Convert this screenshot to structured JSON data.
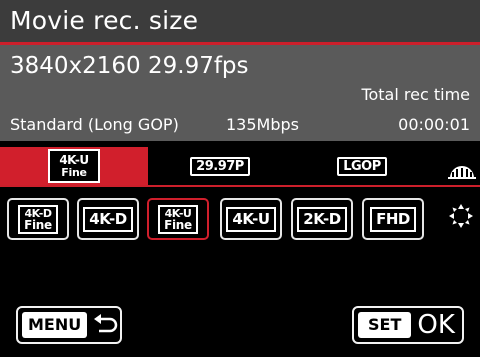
{
  "title": "Movie rec. size",
  "info": {
    "resolution_fps": "3840x2160 29.97fps",
    "total_rec_label": "Total rec time",
    "mode": "Standard (Long GOP)",
    "bitrate": "135Mbps",
    "time": "00:00:01"
  },
  "tabs": [
    {
      "line1": "4K-U",
      "line2": "Fine",
      "active": true
    },
    {
      "label": "29.97P"
    },
    {
      "label": "LGOP"
    }
  ],
  "options": [
    {
      "line1": "4K-D",
      "line2": "Fine"
    },
    {
      "label": "4K-D"
    },
    {
      "line1": "4K-U",
      "line2": "Fine",
      "selected": true
    },
    {
      "label": "4K-U"
    },
    {
      "label": "2K-D"
    },
    {
      "label": "FHD"
    }
  ],
  "buttons": {
    "menu_label": "MENU",
    "set_label": "SET",
    "ok_label": "OK"
  },
  "colors": {
    "accent_red": "#d11f2c",
    "title_bg": "#3c3c3c",
    "info_bg": "#5a5a5a"
  }
}
